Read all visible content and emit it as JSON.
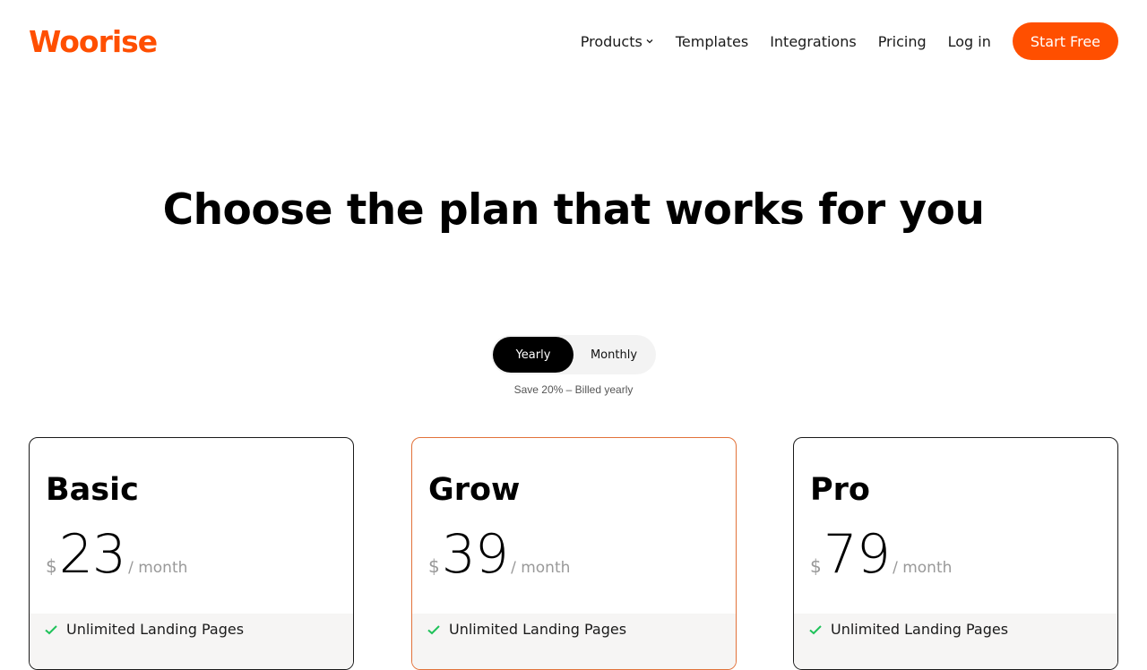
{
  "brand": {
    "name": "Woorise",
    "color": "#ff4f00"
  },
  "nav": {
    "items": [
      {
        "label": "Products",
        "has_dropdown": true
      },
      {
        "label": "Templates"
      },
      {
        "label": "Integrations"
      },
      {
        "label": "Pricing"
      },
      {
        "label": "Log in"
      }
    ],
    "cta_label": "Start Free"
  },
  "hero": {
    "title": "Choose the plan that works for you"
  },
  "billing_toggle": {
    "options": [
      "Yearly",
      "Monthly"
    ],
    "selected": "Yearly",
    "note": "Save 20% – Billed yearly"
  },
  "plans": [
    {
      "name": "Basic",
      "currency": "$",
      "price": "23",
      "period": "/ month",
      "features": [
        "Unlimited Landing Pages"
      ]
    },
    {
      "name": "Grow",
      "currency": "$",
      "price": "39",
      "period": "/ month",
      "features": [
        "Unlimited Landing Pages"
      ],
      "featured": true
    },
    {
      "name": "Pro",
      "currency": "$",
      "price": "79",
      "period": "/ month",
      "features": [
        "Unlimited Landing Pages"
      ]
    }
  ],
  "icons": {
    "check": "check-icon",
    "dropdown": "chevron-down-icon"
  },
  "colors": {
    "accent": "#ff4f00",
    "check": "#1fc25a",
    "featured_border": "#e2723a"
  }
}
